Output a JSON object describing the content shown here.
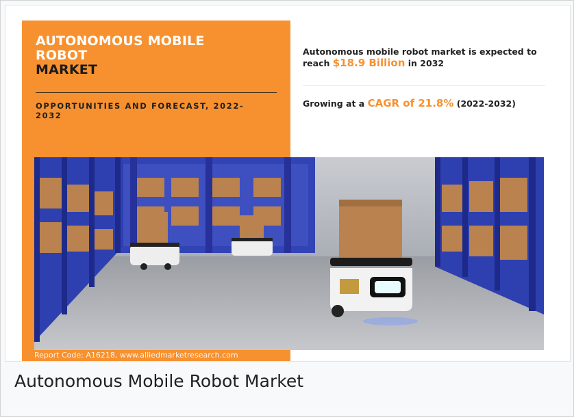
{
  "headline": {
    "line1": "AUTONOMOUS MOBILE",
    "line2": "ROBOT",
    "line3": "MARKET"
  },
  "subheading": "OPPORTUNITIES AND FORECAST, 2022-2032",
  "stats": {
    "market": {
      "prefix": "Autonomous mobile robot market is expected to reach",
      "value": "$18.9 Billion",
      "suffix": "in 2032"
    },
    "cagr": {
      "prefix": "Growing at a",
      "value": "CAGR of 21.8%",
      "suffix": "(2022-2032)"
    }
  },
  "footer_code": "Report Code: A16218, www.alliedmarketresearch.com",
  "caption": "Autonomous Mobile Robot Market",
  "colors": {
    "accent_orange": "#f7912f",
    "rack_blue": "#2e3fb0",
    "box_brown": "#b9824f"
  },
  "photo": {
    "description_icon": "warehouse-robots-photo"
  }
}
